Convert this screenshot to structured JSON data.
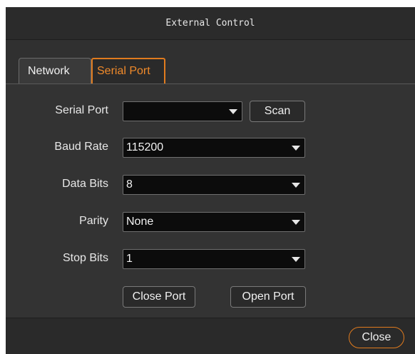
{
  "window": {
    "title": "External Control"
  },
  "tabs": [
    {
      "label": "Network",
      "active": false
    },
    {
      "label": "Serial Port",
      "active": true
    }
  ],
  "form": {
    "serial_port": {
      "label": "Serial Port",
      "value": "",
      "scan_label": "Scan"
    },
    "baud_rate": {
      "label": "Baud Rate",
      "value": "115200"
    },
    "data_bits": {
      "label": "Data Bits",
      "value": "8"
    },
    "parity": {
      "label": "Parity",
      "value": "None"
    },
    "stop_bits": {
      "label": "Stop Bits",
      "value": "1"
    },
    "close_port_label": "Close Port",
    "open_port_label": "Open Port"
  },
  "footer": {
    "close_label": "Close"
  },
  "colors": {
    "accent": "#e07b1e",
    "background": "#303030",
    "field": "#0c0c0c"
  },
  "icons": {
    "dropdown": "caret-down-icon"
  }
}
